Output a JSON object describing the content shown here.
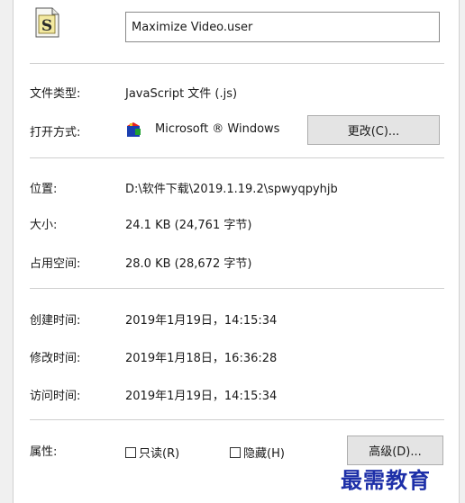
{
  "file": {
    "name": "Maximize Video.user",
    "icon": "script-file-icon"
  },
  "rows": {
    "type": {
      "label": "文件类型:",
      "value": "JavaScript 文件 (.js)"
    },
    "opens_with": {
      "label": "打开方式:",
      "value": "Microsoft ® Windows",
      "icon": "windows-script-host-icon",
      "change_button": "更改(C)..."
    },
    "location": {
      "label": "位置:",
      "value": "D:\\软件下载\\2019.1.19.2\\spwyqpyhjb"
    },
    "size": {
      "label": "大小:",
      "value": "24.1 KB (24,761 字节)"
    },
    "disk_size": {
      "label": "占用空间:",
      "value": "28.0 KB (28,672 字节)"
    },
    "created": {
      "label": "创建时间:",
      "value": "2019年1月19日，14:15:34"
    },
    "modified": {
      "label": "修改时间:",
      "value": "2019年1月18日，16:36:28"
    },
    "accessed": {
      "label": "访问时间:",
      "value": "2019年1月19日，14:15:34"
    },
    "attributes": {
      "label": "属性:",
      "readonly": {
        "label": "只读(R)",
        "checked": false
      },
      "hidden": {
        "label": "隐藏(H)",
        "checked": false
      },
      "advanced_button": "高级(D)..."
    }
  },
  "watermark": "最需教育",
  "colors": {
    "watermark": "#1d2fa8",
    "separator": "#cfcfcf",
    "button_bg": "#e4e4e4"
  }
}
